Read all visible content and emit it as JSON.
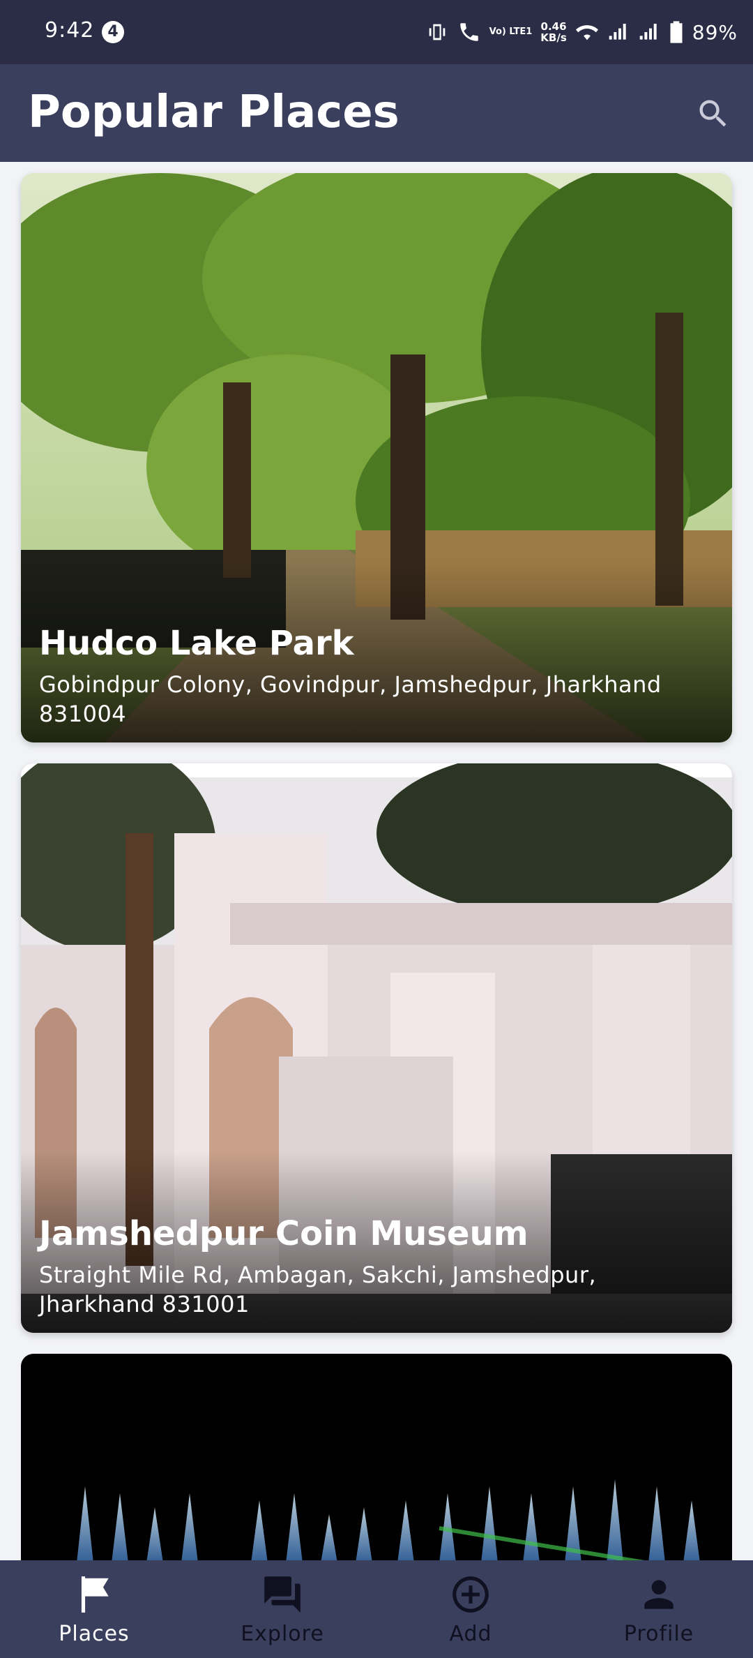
{
  "status_bar": {
    "time": "9:42",
    "notification_count": "4",
    "volte_label": "Vo) LTE1",
    "speed_value": "0.46",
    "speed_unit": "KB/s",
    "battery": "89%"
  },
  "app_bar": {
    "title": "Popular Places",
    "search_icon": "search-icon"
  },
  "places": [
    {
      "title": "Hudco Lake Park",
      "address": "Gobindpur Colony, Govindpur, Jamshedpur, Jharkhand 831004"
    },
    {
      "title": "Jamshedpur Coin Museum",
      "address": "Straight Mile Rd, Ambagan, Sakchi, Jamshedpur, Jharkhand 831001"
    }
  ],
  "bottom_nav": {
    "items": [
      {
        "label": "Places",
        "icon": "flag-icon",
        "active": true
      },
      {
        "label": "Explore",
        "icon": "forum-icon",
        "active": false
      },
      {
        "label": "Add",
        "icon": "add-circle-icon",
        "active": false
      },
      {
        "label": "Profile",
        "icon": "person-icon",
        "active": false
      }
    ]
  },
  "colors": {
    "status_bar": "#2a2d45",
    "app_bar": "#3b3f5e",
    "background": "#f2f3f7",
    "nav_active": "#ffffff",
    "nav_inactive": "#0f1020"
  }
}
